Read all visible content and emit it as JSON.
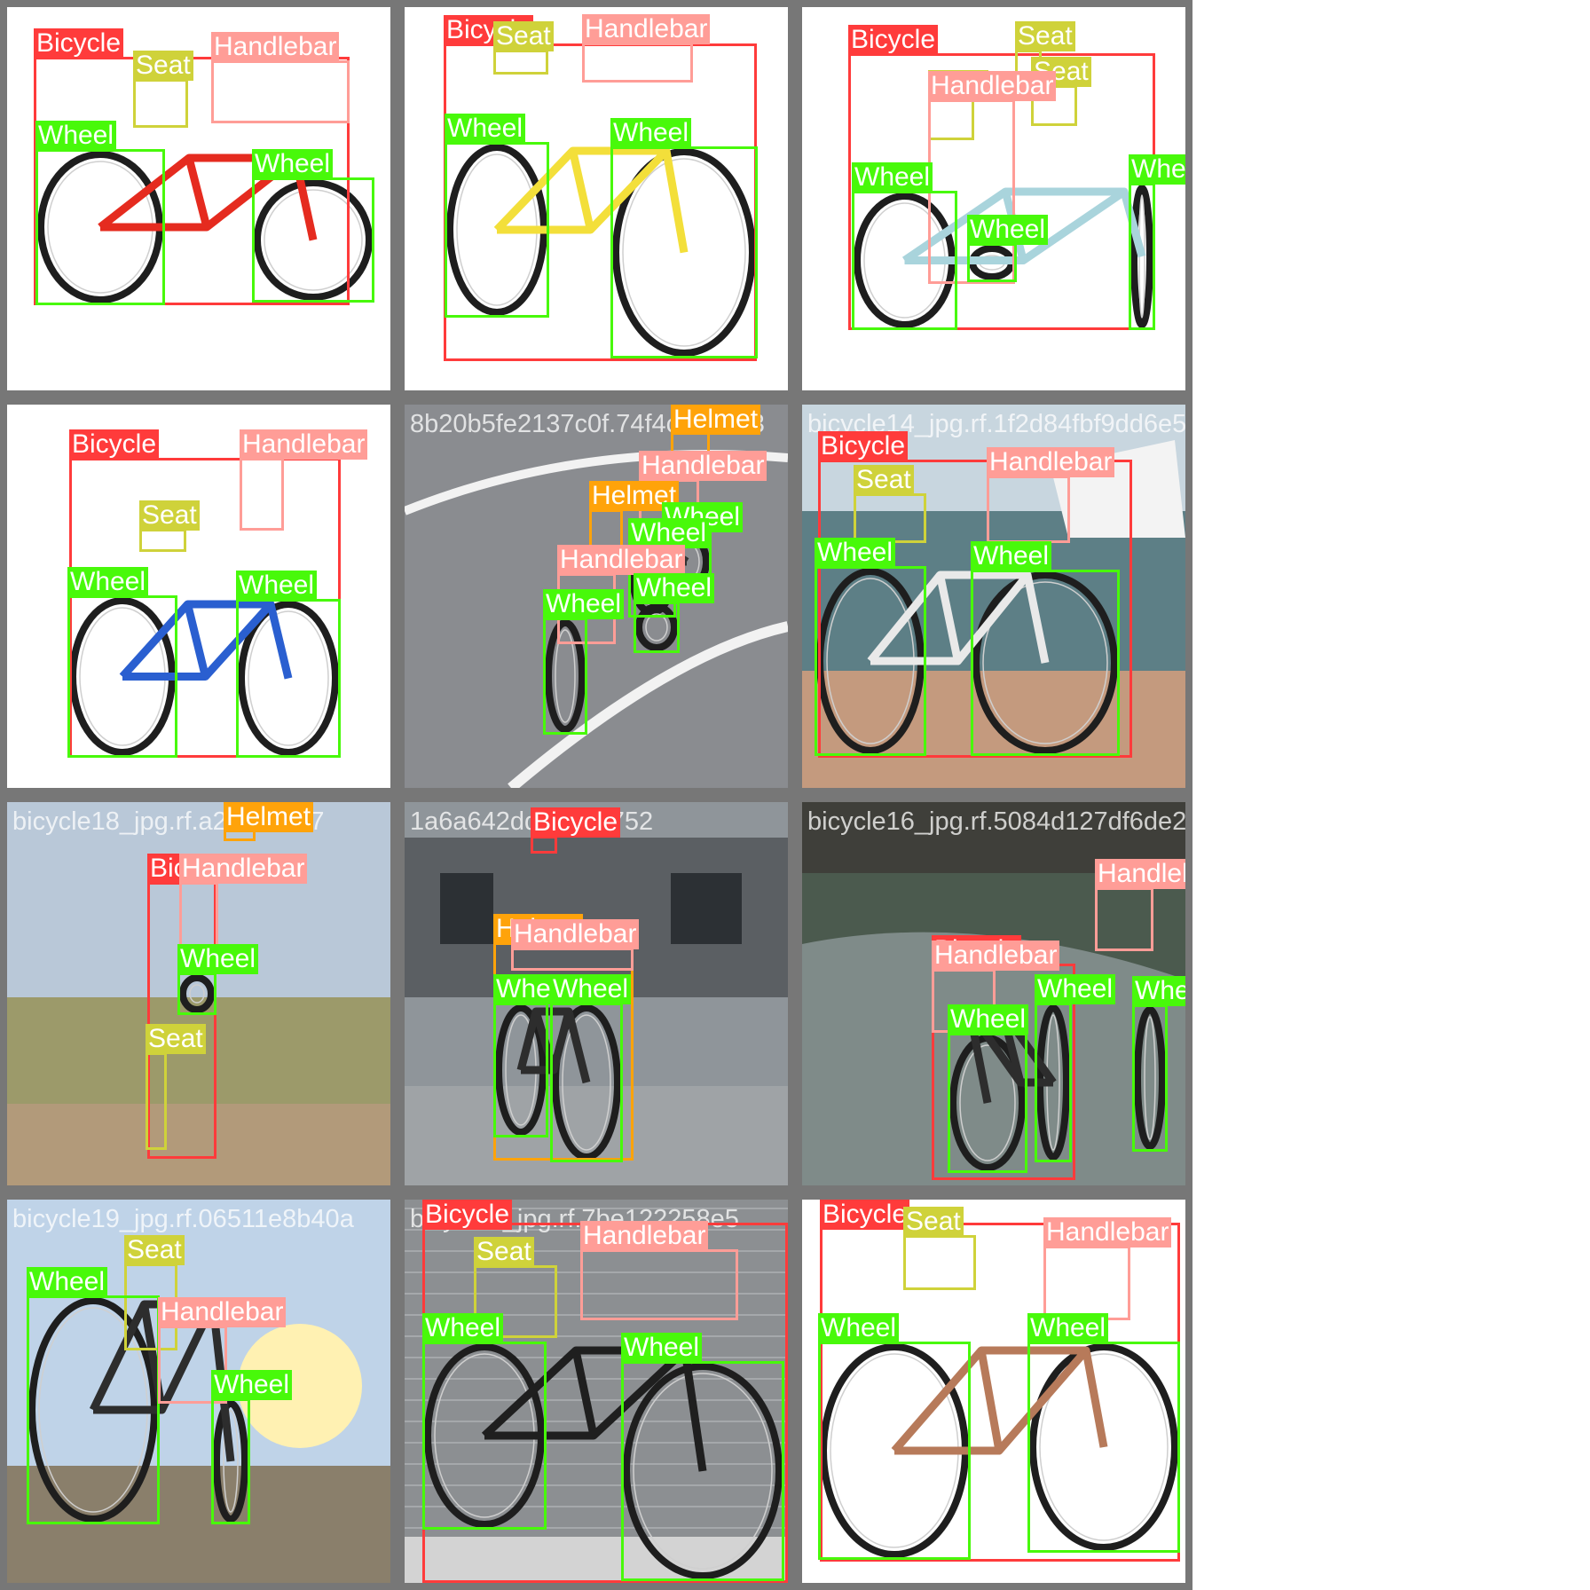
{
  "classes": {
    "Bicycle": {
      "label": "Bicycle",
      "color": "#ff3b3b"
    },
    "Seat": {
      "label": "Seat",
      "color": "#cfd23a"
    },
    "Handlebar": {
      "label": "Handlebar",
      "color": "#ff9d97"
    },
    "Wheel": {
      "label": "Wheel",
      "color": "#48f90a"
    },
    "Helmet": {
      "label": "Helmet",
      "color": "#ffa30a"
    }
  },
  "tiles": [
    {
      "file": "bicycle13_jpg.rf.ee1052af807bb75bd1b833",
      "scene": "white",
      "bike": "#e52b1f",
      "labels": [
        "Bicycle",
        "Seat",
        "Handlebar",
        "Wheel",
        "Wheel"
      ]
    },
    {
      "file": "bicycle17_jpg.rf.75bd1b8332598fa",
      "scene": "white",
      "bike": "#f3df3a",
      "labels": [
        "Bicycle",
        "Seat",
        "Handlebar",
        "Wheel",
        "Wheel"
      ]
    },
    {
      "file": "fai10ff1086_jpg.rf.e45122e2ef3230f535e4e398",
      "scene": "white",
      "bike": "#a9d4dc",
      "labels": [
        "Bicycle",
        "Seat",
        "Seat",
        "Seat",
        "Handlebar",
        "Wheel",
        "Wheel",
        "Wheel"
      ]
    },
    {
      "file": "bicycle1_jpg.rf.",
      "scene": "white",
      "bike": "#2a5fd0",
      "labels": [
        "Bicycle",
        "Handlebar",
        "Seat",
        "Wheel",
        "Wheel"
      ]
    },
    {
      "file": "8b20b5fe2137c0f.74f4c1768b3",
      "scene": "road",
      "bike": "#333333",
      "labels": [
        "Helmet",
        "Handlebar",
        "Helmet",
        "Wheel",
        "Wheel",
        "Handlebar",
        "Wheel",
        "Wheel"
      ]
    },
    {
      "file": "bicycle14_jpg.rf.1f2d84fbf9dd6e5ce29dc93",
      "scene": "dock",
      "bike": "#e9e9e9",
      "labels": [
        "Bicycle",
        "Seat",
        "Handlebar",
        "Wheel",
        "Wheel"
      ]
    },
    {
      "file": "bicycle18_jpg.rf.a2cce3417",
      "scene": "sky",
      "bike": "#2d2d2d",
      "labels": [
        "Helmet",
        "Bicycle",
        "Handlebar",
        "Wheel",
        "Seat"
      ]
    },
    {
      "file": "1a6a642dd707e0752",
      "scene": "street",
      "bike": "#2d2d2d",
      "labels": [
        "Helmet",
        "Bicycle",
        "Handlebar",
        "Wheel",
        "Wheel"
      ]
    },
    {
      "file": "bicycle16_jpg.rf.5084d127df6de2190b6b24d",
      "scene": "hill",
      "bike": "#2d2d2d",
      "labels": [
        "Handlebar",
        "Bicycle",
        "Handlebar",
        "Wheel",
        "Wheel",
        "Wheel"
      ]
    },
    {
      "file": "bicycle19_jpg.rf.06511e8b40a",
      "scene": "sunset",
      "bike": "#2d2d2d",
      "labels": [
        "Seat",
        "Wheel",
        "Handlebar",
        "Wheel"
      ]
    },
    {
      "file": "bicycle2_jpg.rf.7be122258e5",
      "scene": "brick",
      "bike": "#1f1f1f",
      "labels": [
        "Bicycle",
        "Seat",
        "Handlebar",
        "Wheel",
        "Wheel"
      ]
    },
    {
      "file": "bicycle15_jpg.rf.e3c96848c0c1a4",
      "scene": "white",
      "bike": "#b77a5a",
      "labels": [
        "Bicycle",
        "Seat",
        "Handlebar",
        "Wheel",
        "Wheel"
      ]
    }
  ]
}
